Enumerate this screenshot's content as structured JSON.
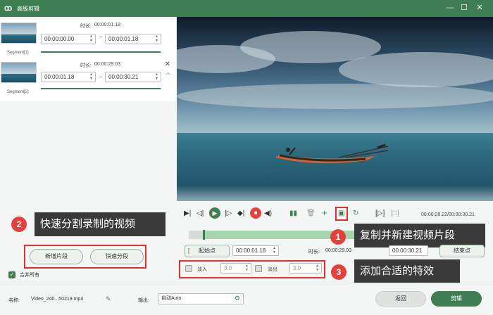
{
  "window": {
    "title": "高级剪辑",
    "logo": "ꝏ",
    "minimize": "—",
    "maximize": "☐",
    "close": "✕"
  },
  "segments": [
    {
      "name": "Segment[1]",
      "duration_label": "时长:",
      "duration": "00:00:01.18",
      "start": "00:00:00.00",
      "end": "00:00:01.18"
    },
    {
      "name": "Segment[2]",
      "duration_label": "时长:",
      "duration": "00:00:29.03",
      "start": "00:00:01.18",
      "end": "00:00:30.21"
    }
  ],
  "callouts": {
    "split": {
      "badge": "2",
      "text": "快速分割录制的视频"
    },
    "copy": {
      "badge": "1",
      "text": "复制并新建视频片段"
    },
    "effect": {
      "badge": "3",
      "text": "添加合适的特效"
    }
  },
  "buttons": {
    "new_segment": "新增片段",
    "quick_split": "快速分段",
    "merge_all": "合并所有",
    "start_point": "起始点",
    "end_point": "结束点",
    "back": "返回",
    "cut": "剪辑"
  },
  "player": {
    "time_display": "00:00:28.22/00:00:30.21"
  },
  "trim": {
    "start_value": "00:00:01.18",
    "duration_label": "时长:",
    "duration_value": "00:00:29.03",
    "end_value": "00:00:30.21"
  },
  "effects": {
    "fade_in_label": "淡入",
    "fade_in_value": "3.0",
    "fade_out_label": "淡出",
    "fade_out_value": "3.0"
  },
  "footer": {
    "name_label": "名称:",
    "name_value": "Video_240...50219.mp4",
    "output_label": "输出:",
    "output_value": "自动Auto"
  },
  "colors": {
    "brand": "#3f7d52",
    "accent_red": "#e0302c",
    "callout_bg": "#3a3a3a"
  }
}
